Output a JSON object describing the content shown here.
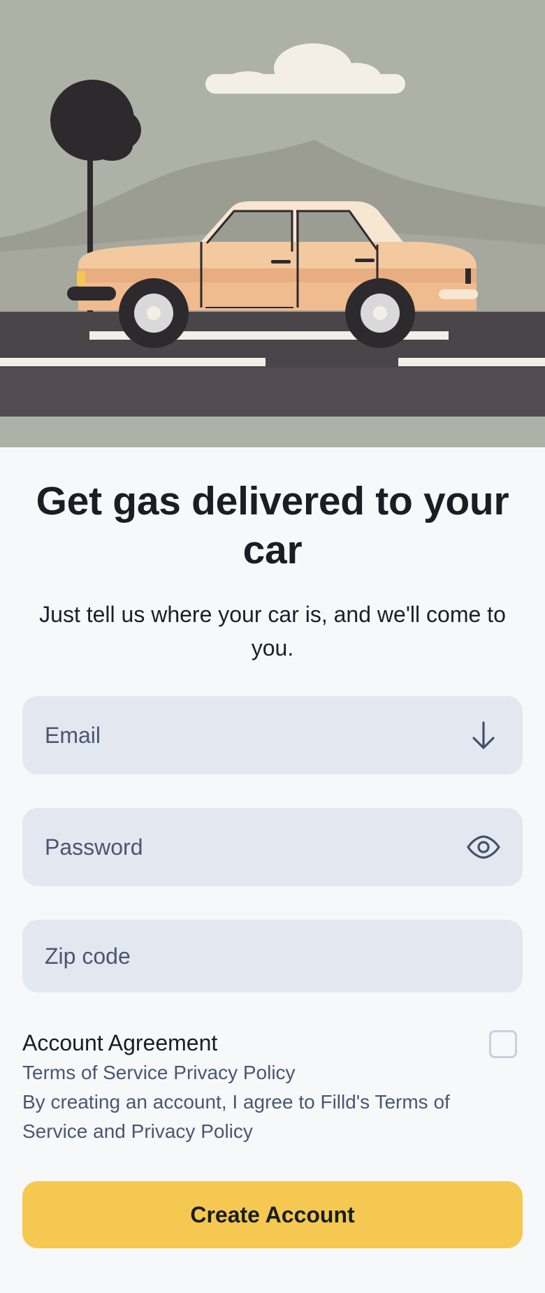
{
  "hero": {
    "colors": {
      "sky": "#aeb1a6",
      "hills": "#9b9d93",
      "road": "#4a4548",
      "car_body": "#f3c9a0",
      "car_stripe": "#e3a77a",
      "cloud": "#f4efe6"
    }
  },
  "headline": "Get gas delivered to your car",
  "subtitle": "Just tell us where your car is, and we'll come to you.",
  "form": {
    "email": {
      "placeholder": "Email",
      "icon": "arrow-down-icon"
    },
    "password": {
      "placeholder": "Password",
      "icon": "eye-icon"
    },
    "zip": {
      "placeholder": "Zip code"
    }
  },
  "agreement": {
    "title": "Account Agreement",
    "links": "Terms of Service Privacy Policy",
    "text": "By creating an account, I agree to Filld's Terms of Service and Privacy Policy",
    "checked": false
  },
  "cta_label": "Create Account",
  "colors": {
    "accent": "#f5c851",
    "field_bg": "#e3e8f0",
    "text_dark": "#1a1d24",
    "text_muted": "#4a5672"
  }
}
